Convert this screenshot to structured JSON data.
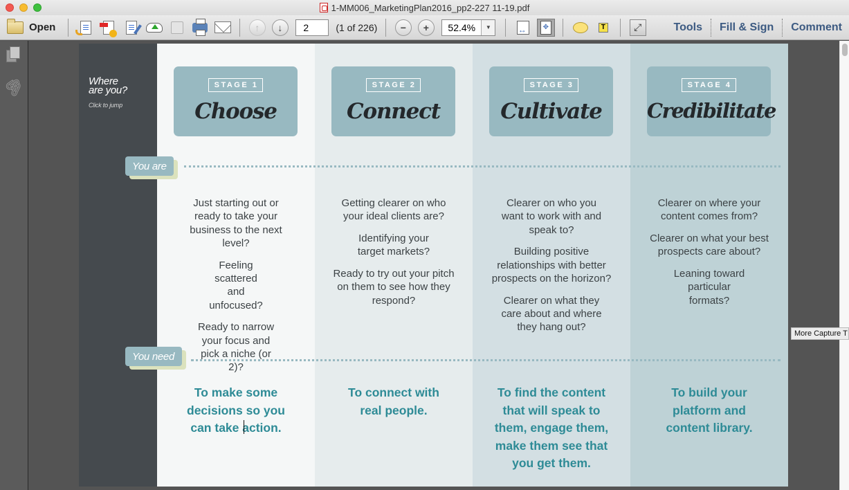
{
  "window": {
    "title": "1-MM006_MarketingPlan2016_pp2-227 11-19.pdf",
    "file_icon": "pdf-file-icon"
  },
  "toolbar": {
    "open_label": "Open",
    "icons": [
      "create-pdf-icon",
      "export-pdf-icon",
      "edit-pdf-icon",
      "upload-cloud-icon",
      "save-icon",
      "print-icon",
      "email-icon"
    ],
    "page_current": "2",
    "page_count": "(1 of 226)",
    "zoom_level": "52.4%",
    "zoom_dropdown_glyph": "▼",
    "zoom_out_glyph": "−",
    "zoom_in_glyph": "+",
    "prev_page_glyph": "↑",
    "next_page_glyph": "↓",
    "fit_page_glyph": "✥",
    "text_note_glyph": "T",
    "fullscreen_glyph": "⤢",
    "links": {
      "tools": "Tools",
      "fill_sign": "Fill & Sign",
      "comment": "Comment"
    }
  },
  "leftnav": {
    "pages_icon": "page-thumbnails-icon",
    "attachments_glyph": "🖇"
  },
  "document": {
    "where_title_line1": "Where",
    "where_title_line2": "are you?",
    "click_to_jump": "Click to jump",
    "you_are_label": "You are",
    "you_need_label": "You need",
    "stages": [
      {
        "tag": "STAGE 1",
        "name": "Choose",
        "you_are": [
          "Just starting out or ready to take your business to the next level?",
          "Feeling scattered and unfocused?",
          "Ready to narrow your focus and pick a niche (or 2)?"
        ],
        "you_need": "To make some decisions so you can take action."
      },
      {
        "tag": "STAGE 2",
        "name": "Connect",
        "you_are": [
          "Getting clearer on who your ideal clients are?",
          "Identifying your target markets?",
          "Ready to try out your pitch on them to see how they respond?"
        ],
        "you_need": "To connect with real people."
      },
      {
        "tag": "STAGE 3",
        "name": "Cultivate",
        "you_are": [
          "Clearer on who you want to work with and speak to?",
          "Building positive relationships with better prospects on the horizon?",
          "Clearer on what they care about and where they hang out?"
        ],
        "you_need": "To find the content that will speak to them, engage them, make them see that you get them."
      },
      {
        "tag": "STAGE 4",
        "name": "Credibilitate",
        "you_are": [
          "Clearer on where your content comes from?",
          "Clearer on what your best prospects care about?",
          "Leaning toward particular formats?"
        ],
        "you_need": "To build your platform and content library."
      }
    ]
  },
  "tooltip": "More Capture T",
  "colors": {
    "stage_card": "#98b9c1",
    "need_text": "#2e8b96",
    "sidebar_dark": "#454a4e",
    "link_blue": "#3c5a82"
  }
}
